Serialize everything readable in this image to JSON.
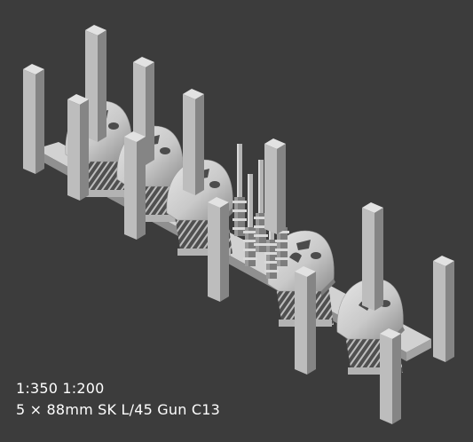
{
  "caption": {
    "scales": "1:350 1:200",
    "title": "5 × 88mm SK L/45 Gun C13"
  },
  "colors": {
    "background": "#3c3c3c",
    "model_light": "#d9d9d9",
    "model_mid": "#b3b3b3",
    "model_dark": "#7d7d7d",
    "model_shadow": "#4c4c4c",
    "caption_text": "#ffffff"
  },
  "model": {
    "guns": 5,
    "barrels": 5,
    "sprue_posts": 11
  }
}
